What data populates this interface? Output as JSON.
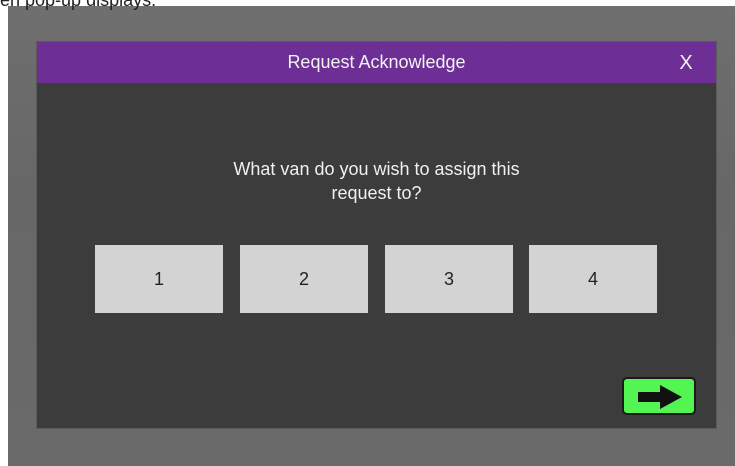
{
  "background": {
    "top_text": "en pop-up displays."
  },
  "dialog": {
    "title": "Request Acknowledge",
    "close_label": "X",
    "question_line1": "What van do you wish to assign this",
    "question_line2": "request to?",
    "van_options": [
      "1",
      "2",
      "3",
      "4"
    ],
    "next_icon": "arrow-right-icon"
  },
  "colors": {
    "title_bar": "#6d2f96",
    "dialog_body": "#3c3c3c",
    "option_button": "#d3d3d3",
    "next_button": "#52f552"
  }
}
